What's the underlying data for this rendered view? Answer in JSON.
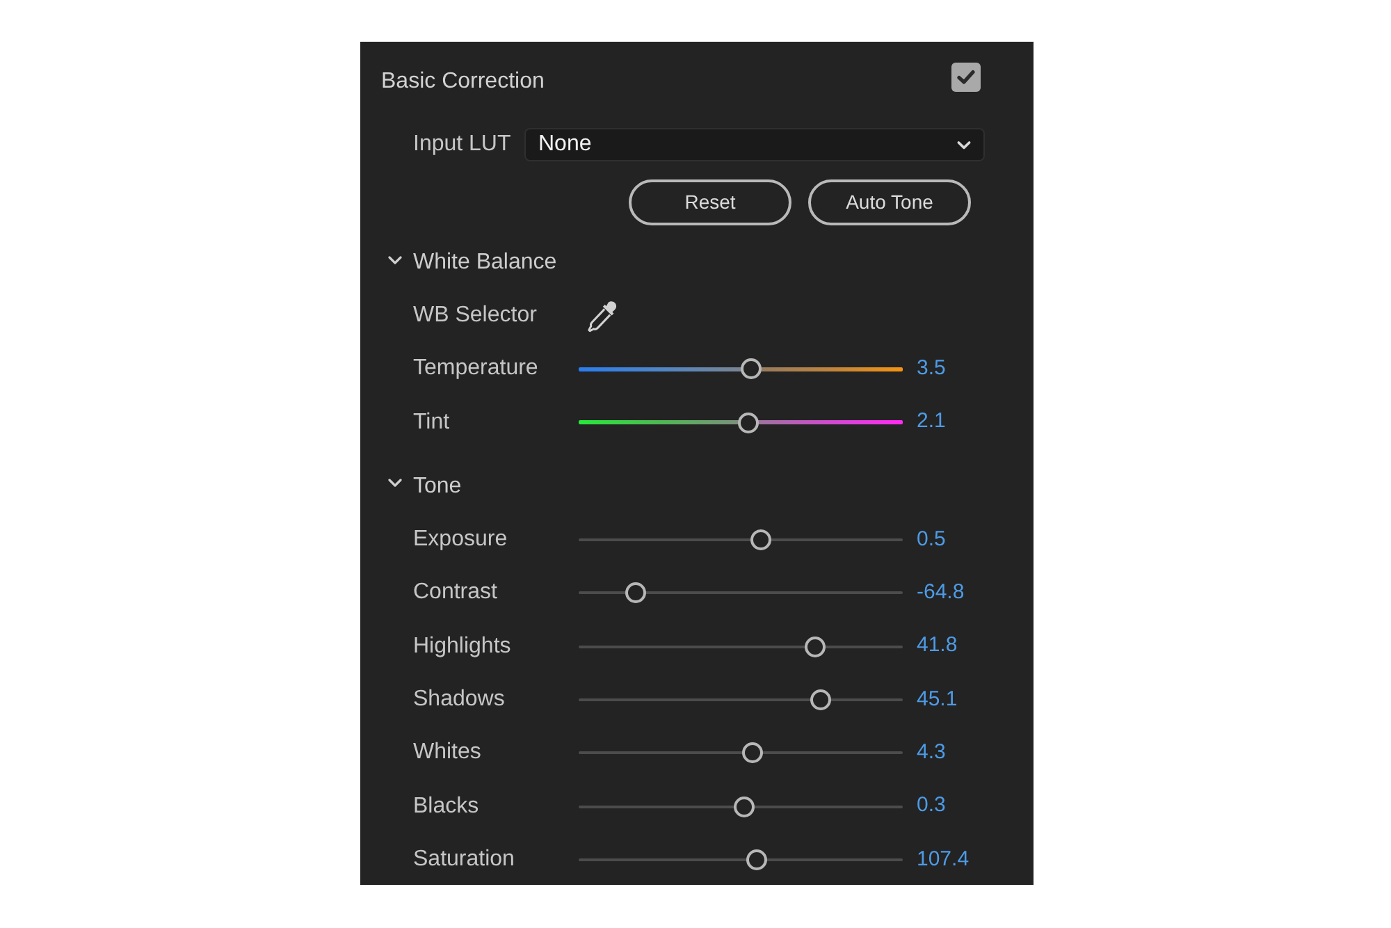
{
  "panel": {
    "title": "Basic Correction",
    "enabled": true
  },
  "input_lut": {
    "label": "Input LUT",
    "value": "None"
  },
  "buttons": [
    "Reset",
    "Auto Tone"
  ],
  "sections": [
    {
      "title": "White Balance",
      "expanded": true,
      "rows": [
        {
          "kind": "picker",
          "label": "WB Selector"
        },
        {
          "kind": "temperature",
          "label": "Temperature",
          "level": 0.532,
          "reading": "3.5"
        },
        {
          "kind": "tint",
          "label": "Tint",
          "level": 0.524,
          "reading": "2.1"
        }
      ]
    },
    {
      "title": "Tone",
      "expanded": true,
      "rows": [
        {
          "kind": "plain",
          "label": "Exposure",
          "level": 0.562,
          "reading": "0.5"
        },
        {
          "kind": "plain",
          "label": "Contrast",
          "level": 0.176,
          "reading": "-64.8"
        },
        {
          "kind": "plain",
          "label": "Highlights",
          "level": 0.73,
          "reading": "41.8"
        },
        {
          "kind": "plain",
          "label": "Shadows",
          "level": 0.747,
          "reading": "45.1"
        },
        {
          "kind": "plain",
          "label": "Whites",
          "level": 0.536,
          "reading": "4.3"
        },
        {
          "kind": "plain",
          "label": "Blacks",
          "level": 0.511,
          "reading": "0.3"
        },
        {
          "kind": "plain",
          "label": "Saturation",
          "level": 0.549,
          "reading": "107.4"
        }
      ]
    }
  ]
}
